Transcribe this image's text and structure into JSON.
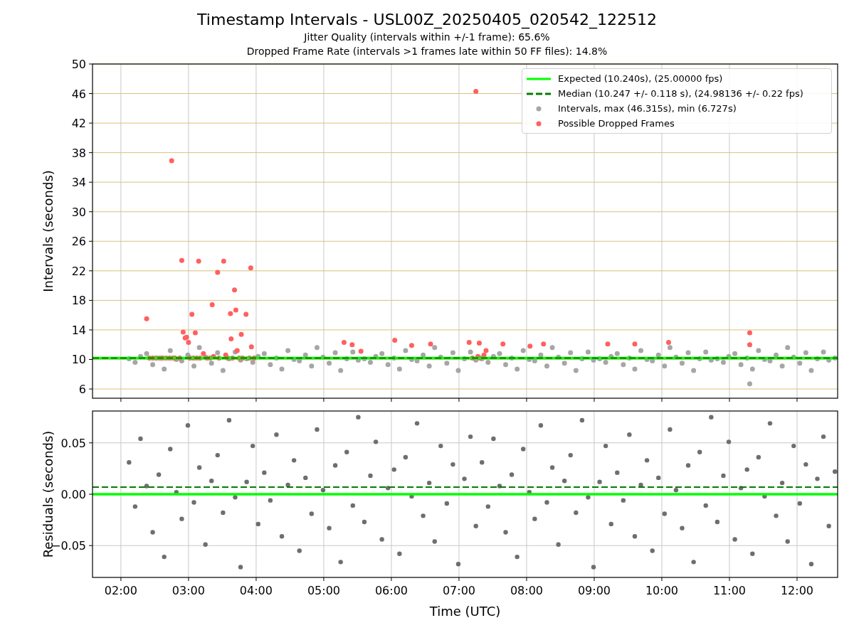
{
  "figure": {
    "title": "Timestamp Intervals - USL00Z_20250405_020542_122512",
    "subtitles": [
      "Jitter Quality (intervals within +/-1 frame): 65.6%",
      "Dropped Frame Rate (intervals >1 frames late within 50 FF files): 14.8%"
    ]
  },
  "charts": [
    {
      "chart_data": {
        "type": "scatter",
        "ylabel": "Intervals (seconds)",
        "xlim": [
          1.58,
          12.6
        ],
        "ylim": [
          4.75,
          50
        ],
        "yticks": [
          6,
          10,
          14,
          18,
          22,
          26,
          30,
          34,
          38,
          42,
          46,
          50
        ],
        "grid": true,
        "series": [
          {
            "type": "line",
            "line_style": "solid",
            "name": "Expected (10.240s), (25.00000 fps)",
            "color": "#00ff00",
            "x": [
              1.58,
              12.6
            ],
            "values": [
              10.2,
              10.2
            ]
          },
          {
            "type": "line",
            "line_style": "dashed",
            "name": "Median (10.247 +/- 0.118 s), (24.98136 +/- 0.22 fps)",
            "color": "#007f00",
            "x": [
              1.58,
              12.6
            ],
            "values": [
              10.2,
              10.2
            ]
          },
          {
            "type": "scatter",
            "name": "Intervals, max (46.315s), min (6.727s)",
            "color": "#a6a6a6",
            "x": [
              2.12,
              2.21,
              2.29,
              2.38,
              2.47,
              2.56,
              2.64,
              2.73,
              2.82,
              2.9,
              2.99,
              3.08,
              3.16,
              3.25,
              3.34,
              3.43,
              3.51,
              3.6,
              3.69,
              3.77,
              3.86,
              3.95,
              4.03,
              4.12,
              4.21,
              4.3,
              4.38,
              4.47,
              4.56,
              4.64,
              4.73,
              4.82,
              4.9,
              4.99,
              5.08,
              5.17,
              5.25,
              5.34,
              5.43,
              5.51,
              5.6,
              5.69,
              5.77,
              5.86,
              5.95,
              6.04,
              6.12,
              6.21,
              6.3,
              6.38,
              6.47,
              6.56,
              6.64,
              6.73,
              6.82,
              6.91,
              6.99,
              7.08,
              7.17,
              7.25,
              7.34,
              7.43,
              7.51,
              7.6,
              7.69,
              7.78,
              7.86,
              7.95,
              8.04,
              8.12,
              8.21,
              8.3,
              8.38,
              8.47,
              8.56,
              8.65,
              8.73,
              8.82,
              8.91,
              8.99,
              9.08,
              9.17,
              9.25,
              9.34,
              9.43,
              9.52,
              9.6,
              9.69,
              9.78,
              9.86,
              9.95,
              10.04,
              10.12,
              10.21,
              10.3,
              10.39,
              10.47,
              10.56,
              10.65,
              10.73,
              10.82,
              10.91,
              10.99,
              11.08,
              11.17,
              11.26,
              11.3,
              11.34,
              11.43,
              11.52,
              11.6,
              11.69,
              11.78,
              11.86,
              11.95,
              12.04,
              12.13,
              12.21,
              12.3,
              12.39,
              12.47,
              12.56
            ],
            "values": [
              10.1,
              9.6,
              10.4,
              10.8,
              9.3,
              10.2,
              8.7,
              11.2,
              10.0,
              9.8,
              10.6,
              9.1,
              11.6,
              10.3,
              9.5,
              10.9,
              8.5,
              10.1,
              11.0,
              9.9,
              10.1,
              9.6,
              10.4,
              10.8,
              9.3,
              10.2,
              8.7,
              11.2,
              10.0,
              9.8,
              10.6,
              9.1,
              11.6,
              10.3,
              9.5,
              10.9,
              8.5,
              10.1,
              11.0,
              9.9,
              10.1,
              9.6,
              10.4,
              10.8,
              9.3,
              10.2,
              8.7,
              11.2,
              10.0,
              9.8,
              10.6,
              9.1,
              11.6,
              10.3,
              9.5,
              10.9,
              8.5,
              10.1,
              11.0,
              9.9,
              10.1,
              9.6,
              10.4,
              10.8,
              9.3,
              10.2,
              8.7,
              11.2,
              10.0,
              9.8,
              10.6,
              9.1,
              11.6,
              10.3,
              9.5,
              10.9,
              8.5,
              10.1,
              11.0,
              9.9,
              10.1,
              9.6,
              10.4,
              10.8,
              9.3,
              10.2,
              8.7,
              11.2,
              10.0,
              9.8,
              10.6,
              9.1,
              11.6,
              10.3,
              9.5,
              10.9,
              8.5,
              10.1,
              11.0,
              9.9,
              10.1,
              9.6,
              10.4,
              10.8,
              9.3,
              10.2,
              6.7,
              8.7,
              11.2,
              10.0,
              9.8,
              10.6,
              9.1,
              11.6,
              10.3,
              9.5,
              10.9,
              8.5,
              10.1,
              11.0,
              9.9,
              10.2
            ]
          },
          {
            "type": "scatter",
            "name": "Possible Dropped Frames",
            "color": "#ff6060",
            "x": [
              2.38,
              2.42,
              2.47,
              2.52,
              2.59,
              2.62,
              2.67,
              2.72,
              2.75,
              2.77,
              2.8,
              2.87,
              2.9,
              2.92,
              2.95,
              2.97,
              3.0,
              3.02,
              3.05,
              3.07,
              3.1,
              3.12,
              3.15,
              3.17,
              3.22,
              3.27,
              3.32,
              3.35,
              3.37,
              3.43,
              3.45,
              3.52,
              3.55,
              3.58,
              3.62,
              3.63,
              3.65,
              3.68,
              3.7,
              3.72,
              3.75,
              3.78,
              3.8,
              3.85,
              3.9,
              3.92,
              3.93,
              3.97,
              5.3,
              5.42,
              5.55,
              6.05,
              6.3,
              6.58,
              7.15,
              7.2,
              7.25,
              7.28,
              7.3,
              7.31,
              7.37,
              7.4,
              7.65,
              8.05,
              8.25,
              9.2,
              9.6,
              10.1,
              11.3,
              11.3
            ],
            "values": [
              15.5,
              10.2,
              10.2,
              10.2,
              10.2,
              10.2,
              10.2,
              10.2,
              36.9,
              10.2,
              10.2,
              10.2,
              23.4,
              13.7,
              12.9,
              13.0,
              12.3,
              10.2,
              16.1,
              10.2,
              13.6,
              10.2,
              23.3,
              10.2,
              10.8,
              10.2,
              10.2,
              17.4,
              10.4,
              21.8,
              10.2,
              23.3,
              10.6,
              10.2,
              16.2,
              12.8,
              10.2,
              19.4,
              16.7,
              11.2,
              10.2,
              13.4,
              10.2,
              16.1,
              10.2,
              22.4,
              11.7,
              10.2,
              12.3,
              12.0,
              11.1,
              12.6,
              11.9,
              12.1,
              12.3,
              10.2,
              46.3,
              10.4,
              12.2,
              10.2,
              10.6,
              11.2,
              12.1,
              11.8,
              12.1,
              12.1,
              12.1,
              12.3,
              13.6,
              12.0
            ]
          }
        ]
      }
    },
    {
      "chart_data": {
        "type": "scatter",
        "xlabel": "Time (UTC)",
        "ylabel": "Residuals (seconds)",
        "xlim": [
          1.58,
          12.6
        ],
        "ylim": [
          -0.081,
          0.081
        ],
        "xticks": [
          {
            "value": 2,
            "label": "02:00"
          },
          {
            "value": 3,
            "label": "03:00"
          },
          {
            "value": 4,
            "label": "04:00"
          },
          {
            "value": 5,
            "label": "05:00"
          },
          {
            "value": 6,
            "label": "06:00"
          },
          {
            "value": 7,
            "label": "07:00"
          },
          {
            "value": 8,
            "label": "08:00"
          },
          {
            "value": 9,
            "label": "09:00"
          },
          {
            "value": 10,
            "label": "10:00"
          },
          {
            "value": 11,
            "label": "11:00"
          },
          {
            "value": 12,
            "label": "12:00"
          }
        ],
        "yticks": [
          {
            "value": 0.05,
            "label": "0.05"
          },
          {
            "value": 0,
            "label": "0.00"
          },
          {
            "value": -0.05,
            "label": "−0.05"
          }
        ],
        "grid": true,
        "series": [
          {
            "type": "line",
            "line_style": "solid",
            "color": "#00ff00",
            "x": [
              1.58,
              12.6
            ],
            "values": [
              0,
              0
            ]
          },
          {
            "type": "line",
            "line_style": "dashed",
            "color": "#007f00",
            "x": [
              1.58,
              12.6
            ],
            "values": [
              0.007,
              0.007
            ]
          },
          {
            "type": "scatter",
            "color": "#6e6e6e",
            "x": [
              2.12,
              2.21,
              2.29,
              2.38,
              2.47,
              2.56,
              2.64,
              2.73,
              2.82,
              2.9,
              2.99,
              3.08,
              3.16,
              3.25,
              3.34,
              3.43,
              3.51,
              3.6,
              3.69,
              3.77,
              3.86,
              3.95,
              4.03,
              4.12,
              4.21,
              4.3,
              4.38,
              4.47,
              4.56,
              4.64,
              4.73,
              4.82,
              4.9,
              4.99,
              5.08,
              5.17,
              5.25,
              5.34,
              5.43,
              5.51,
              5.6,
              5.69,
              5.77,
              5.86,
              5.95,
              6.04,
              6.12,
              6.21,
              6.3,
              6.38,
              6.47,
              6.56,
              6.64,
              6.73,
              6.82,
              6.91,
              6.99,
              7.08,
              7.17,
              7.25,
              7.34,
              7.43,
              7.51,
              7.6,
              7.69,
              7.78,
              7.86,
              7.95,
              8.04,
              8.12,
              8.21,
              8.3,
              8.38,
              8.47,
              8.56,
              8.65,
              8.73,
              8.82,
              8.91,
              8.99,
              9.08,
              9.17,
              9.25,
              9.34,
              9.43,
              9.52,
              9.6,
              9.69,
              9.78,
              9.86,
              9.95,
              10.04,
              10.12,
              10.21,
              10.3,
              10.39,
              10.47,
              10.56,
              10.65,
              10.73,
              10.82,
              10.91,
              10.99,
              11.08,
              11.17,
              11.26,
              11.34,
              11.43,
              11.52,
              11.6,
              11.69,
              11.78,
              11.86,
              11.95,
              12.04,
              12.13,
              12.21,
              12.3,
              12.39,
              12.47,
              12.56
            ],
            "values": [
              0.031,
              -0.012,
              0.054,
              0.008,
              -0.037,
              0.019,
              -0.061,
              0.044,
              0.002,
              -0.024,
              0.067,
              -0.008,
              0.026,
              -0.049,
              0.013,
              0.038,
              -0.018,
              0.072,
              -0.003,
              -0.071,
              0.012,
              0.047,
              -0.029,
              0.021,
              -0.006,
              0.058,
              -0.041,
              0.009,
              0.033,
              -0.055,
              0.016,
              -0.019,
              0.063,
              0.004,
              -0.033,
              0.028,
              -0.066,
              0.041,
              -0.011,
              0.075,
              -0.027,
              0.018,
              0.051,
              -0.044,
              0.006,
              0.024,
              -0.058,
              0.036,
              -0.002,
              0.069,
              -0.021,
              0.011,
              -0.046,
              0.047,
              -0.009,
              0.029,
              -0.068,
              0.015,
              0.056,
              -0.031,
              0.031,
              -0.012,
              0.054,
              0.008,
              -0.037,
              0.019,
              -0.061,
              0.044,
              0.002,
              -0.024,
              0.067,
              -0.008,
              0.026,
              -0.049,
              0.013,
              0.038,
              -0.018,
              0.072,
              -0.003,
              -0.071,
              0.012,
              0.047,
              -0.029,
              0.021,
              -0.006,
              0.058,
              -0.041,
              0.009,
              0.033,
              -0.055,
              0.016,
              -0.019,
              0.063,
              0.004,
              -0.033,
              0.028,
              -0.066,
              0.041,
              -0.011,
              0.075,
              -0.027,
              0.018,
              0.051,
              -0.044,
              0.006,
              0.024,
              -0.058,
              0.036,
              -0.002,
              0.069,
              -0.021,
              0.011,
              -0.046,
              0.047,
              -0.009,
              0.029,
              -0.068,
              0.015,
              0.056,
              -0.031,
              0.022
            ]
          }
        ]
      }
    }
  ]
}
